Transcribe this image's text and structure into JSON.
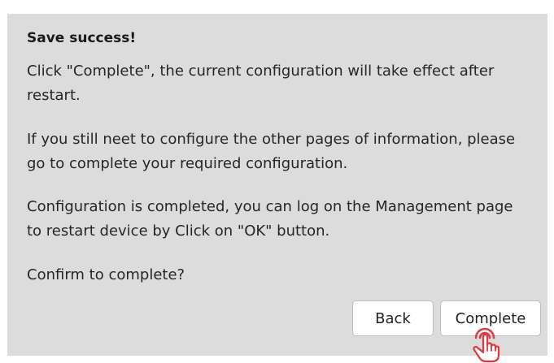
{
  "dialog": {
    "title": "Save success!",
    "paragraphs": [
      "Click \"Complete\", the current configuration will take effect after restart.",
      "If you still neet to configure the other pages of information, please go to complete your required configuration.",
      "Configuration is completed, you can log on the Management page to restart device by Click on \"OK\" button.",
      "Confirm to complete?"
    ],
    "buttons": {
      "back_label": "Back",
      "complete_label": "Complete"
    }
  },
  "icons": {
    "cursor": "hand-pointer-icon"
  },
  "colors": {
    "dialog_background": "#dcdcdc",
    "button_background": "#ffffff",
    "cursor_accent": "#e0383e"
  }
}
